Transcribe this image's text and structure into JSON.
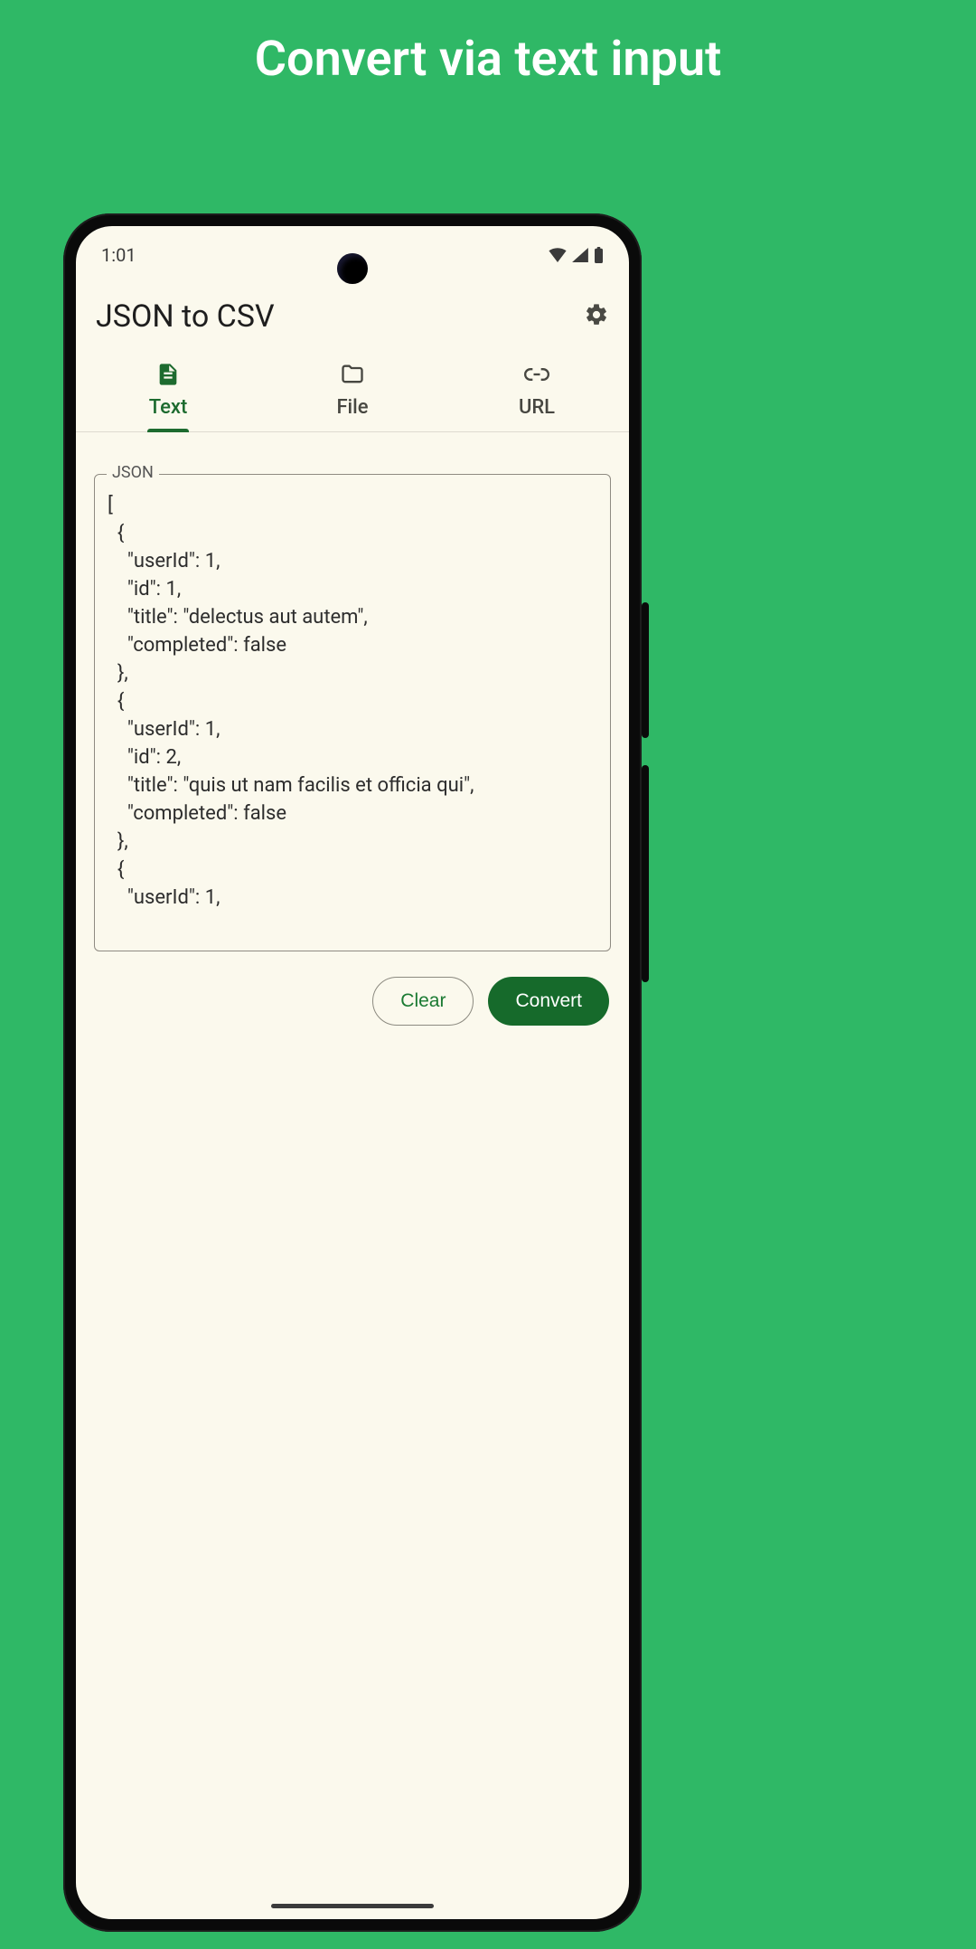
{
  "promo": {
    "title": "Convert via text input"
  },
  "statusbar": {
    "time": "1:01"
  },
  "header": {
    "title": "JSON to CSV"
  },
  "tabs": [
    {
      "label": "Text",
      "icon": "text-snippet-icon",
      "active": true
    },
    {
      "label": "File",
      "icon": "folder-icon",
      "active": false
    },
    {
      "label": "URL",
      "icon": "link-icon",
      "active": false
    }
  ],
  "input": {
    "label": "JSON",
    "value": "[\n  {\n    \"userId\": 1,\n    \"id\": 1,\n    \"title\": \"delectus aut autem\",\n    \"completed\": false\n  },\n  {\n    \"userId\": 1,\n    \"id\": 2,\n    \"title\": \"quis ut nam facilis et officia qui\",\n    \"completed\": false\n  },\n  {\n    \"userId\": 1,"
  },
  "actions": {
    "clear": "Clear",
    "convert": "Convert"
  },
  "colors": {
    "bg": "#2fb866",
    "accent": "#1d6b2f",
    "surface": "#fbf9ed"
  }
}
